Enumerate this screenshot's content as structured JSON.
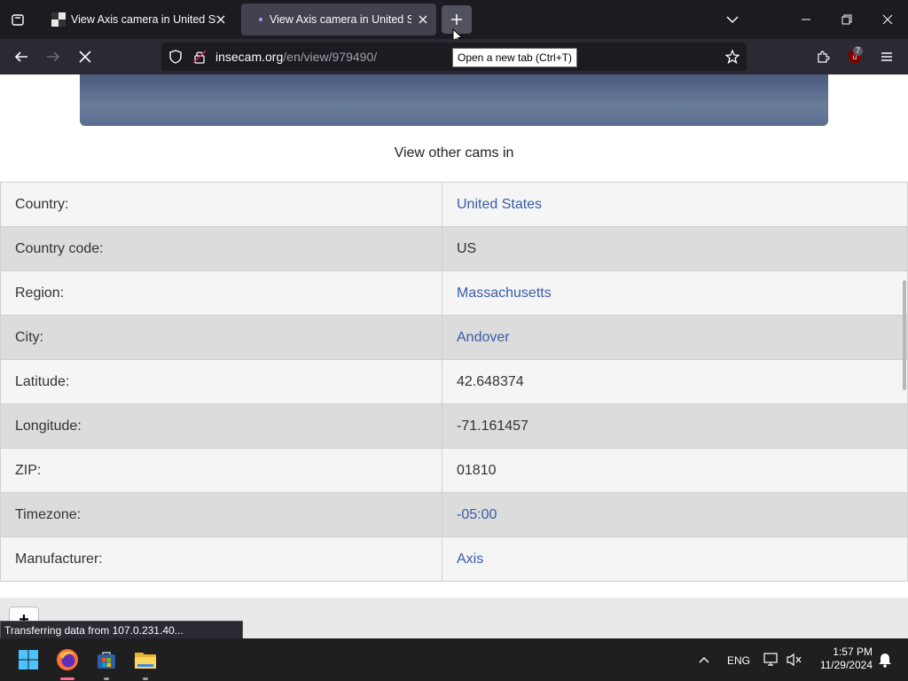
{
  "browser": {
    "tabs": [
      {
        "title": "View Axis camera in United States"
      },
      {
        "title": "View Axis camera in United States"
      }
    ],
    "url_host": "insecam.org",
    "url_path": "/en/view/979490/",
    "tooltip": "Open a new tab (Ctrl+T)",
    "extension_badge": "7"
  },
  "page": {
    "other_cams_text": "View other cams in",
    "rows": [
      {
        "label": "Country:",
        "value": "United States",
        "link": true
      },
      {
        "label": "Country code:",
        "value": "US",
        "link": false
      },
      {
        "label": "Region:",
        "value": "Massachusetts",
        "link": true
      },
      {
        "label": "City:",
        "value": "Andover",
        "link": true
      },
      {
        "label": "Latitude:",
        "value": "42.648374",
        "link": false
      },
      {
        "label": "Longitude:",
        "value": "-71.161457",
        "link": false
      },
      {
        "label": "ZIP:",
        "value": "01810",
        "link": false
      },
      {
        "label": "Timezone:",
        "value": "-05:00",
        "link": true
      },
      {
        "label": "Manufacturer:",
        "value": "Axis",
        "link": true
      }
    ],
    "plus_label": "+"
  },
  "status_text": "Transferring data from 107.0.231.40...",
  "taskbar": {
    "language": "ENG",
    "time": "1:57 PM",
    "date": "11/29/2024"
  }
}
